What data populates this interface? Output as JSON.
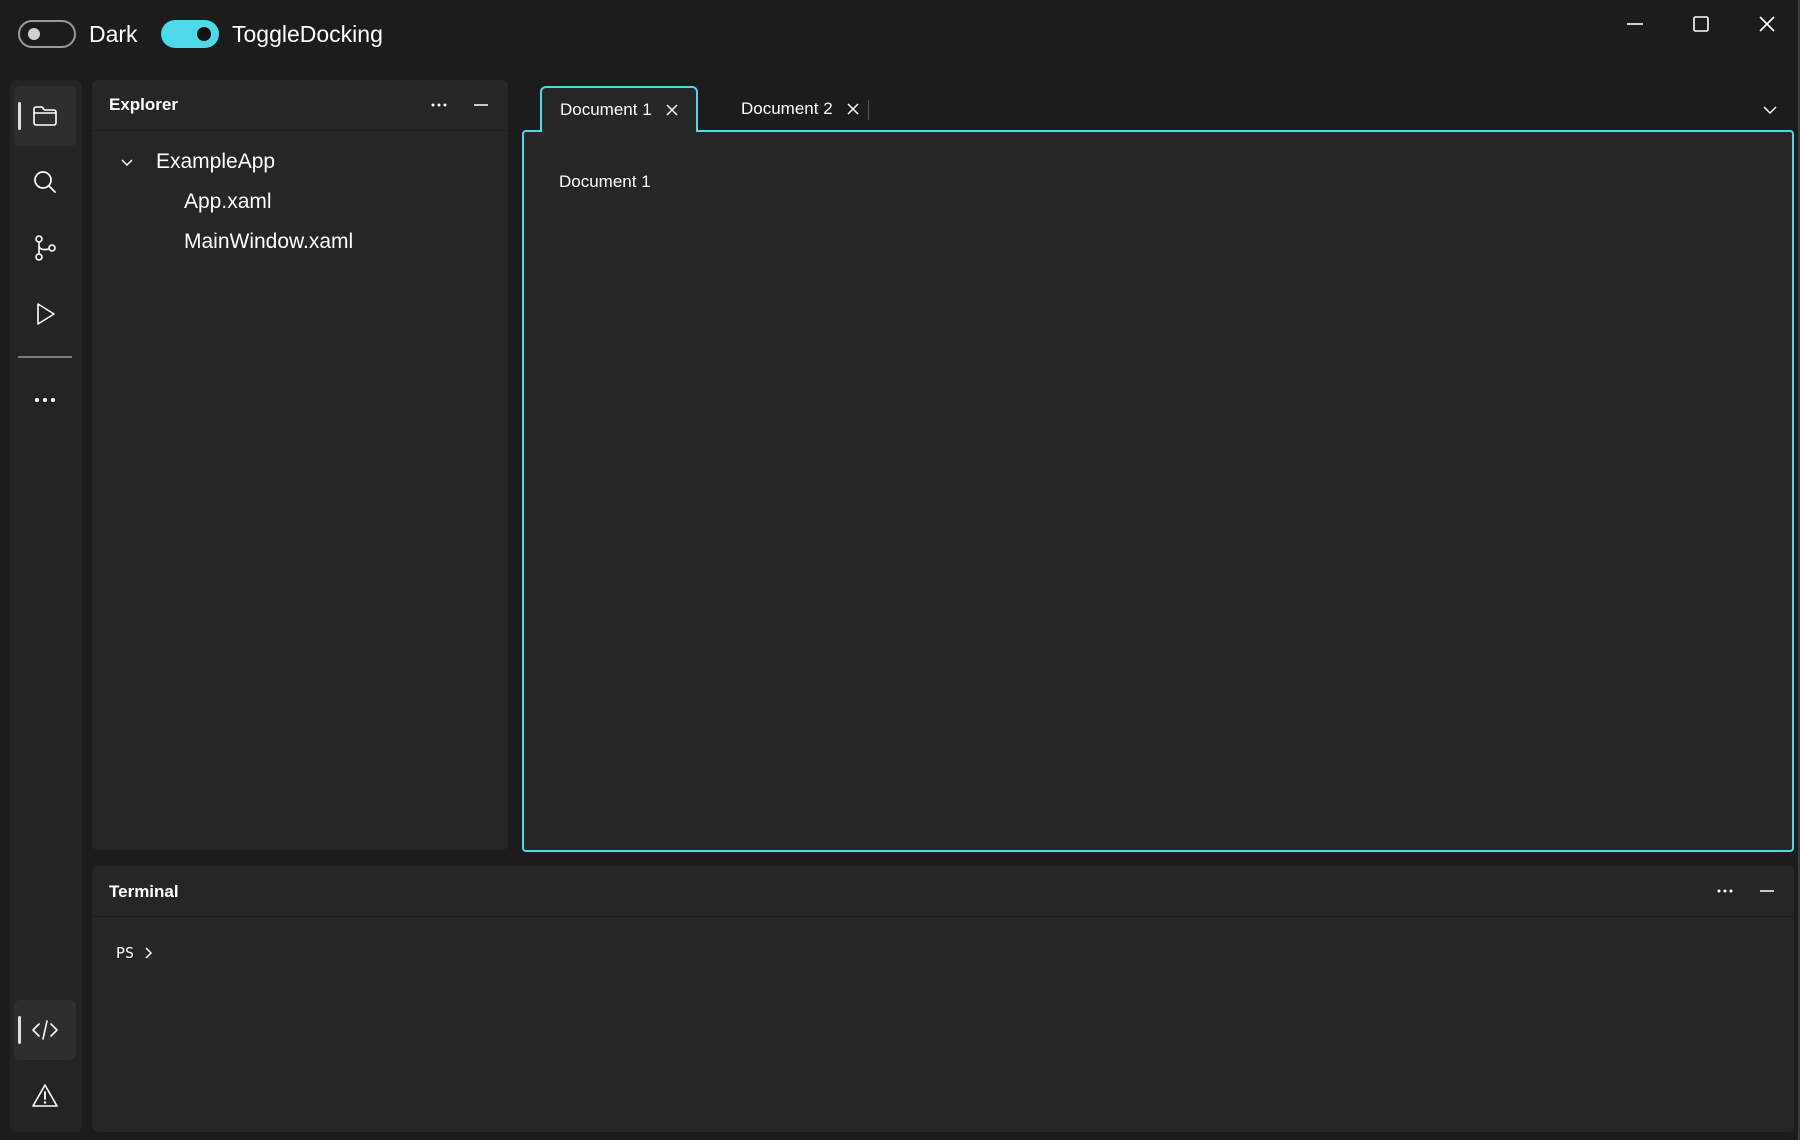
{
  "titlebar": {
    "theme_toggle": {
      "label": "Dark",
      "on": false
    },
    "docking_toggle": {
      "label": "ToggleDocking",
      "on": true
    },
    "caption_buttons": [
      "minimize-icon",
      "maximize-icon",
      "close-icon"
    ]
  },
  "activity_bar": {
    "top_items": [
      {
        "icon": "folder-icon",
        "selected": true
      },
      {
        "icon": "search-icon",
        "selected": false
      },
      {
        "icon": "source-control-icon",
        "selected": false
      },
      {
        "icon": "run-icon",
        "selected": false
      },
      {
        "icon": "more-icon",
        "selected": false
      }
    ],
    "bottom_items": [
      {
        "icon": "code-icon",
        "selected": true
      },
      {
        "icon": "warning-icon",
        "selected": false
      }
    ]
  },
  "explorer": {
    "title": "Explorer",
    "tree": {
      "root": {
        "label": "ExampleApp",
        "expanded": true
      },
      "children": [
        {
          "label": "App.xaml"
        },
        {
          "label": "MainWindow.xaml"
        }
      ]
    }
  },
  "documents": {
    "tabs": [
      {
        "label": "Document 1",
        "active": true
      },
      {
        "label": "Document 2",
        "active": false
      }
    ],
    "content_text": "Document 1"
  },
  "terminal": {
    "title": "Terminal",
    "prompt": "PS"
  },
  "colors": {
    "accent": "#4fd9e8",
    "window_bg": "#1c1c1c",
    "panel_bg": "#262626"
  }
}
